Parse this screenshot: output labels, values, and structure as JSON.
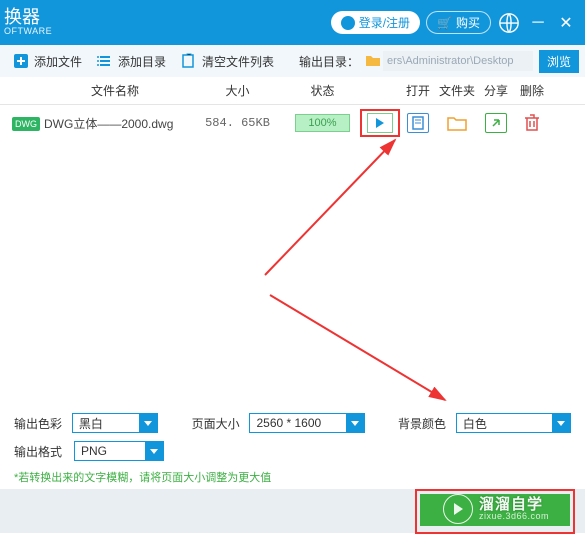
{
  "titlebar": {
    "title": "换器",
    "subtitle": "OFTWARE",
    "login": "登录/注册",
    "buy": "购买"
  },
  "toolbar": {
    "add_file": "添加文件",
    "add_folder": "添加目录",
    "clear_list": "清空文件列表",
    "output_dir_label": "输出目录：",
    "output_dir_value": "ers\\Administrator\\Desktop",
    "browse": "浏览"
  },
  "columns": {
    "name": "文件名称",
    "size": "大小",
    "status": "状态",
    "open": "打开",
    "folder": "文件夹",
    "share": "分享",
    "delete": "删除"
  },
  "row": {
    "badge": "DWG",
    "name": "DWG立体——2000.dwg",
    "size": "584. 65KB",
    "progress": "100%"
  },
  "settings": {
    "color_label": "输出色彩",
    "color_value": "黑白",
    "pagesize_label": "页面大小",
    "pagesize_value": "2560 * 1600",
    "bg_label": "背景颜色",
    "bg_value": "白色",
    "format_label": "输出格式",
    "format_value": "PNG",
    "hint": "*若转换出来的文字模糊，请将页面大小调整为更大值"
  },
  "watermark": {
    "main": "溜溜自学",
    "sub": "zixue.3d66.com"
  }
}
